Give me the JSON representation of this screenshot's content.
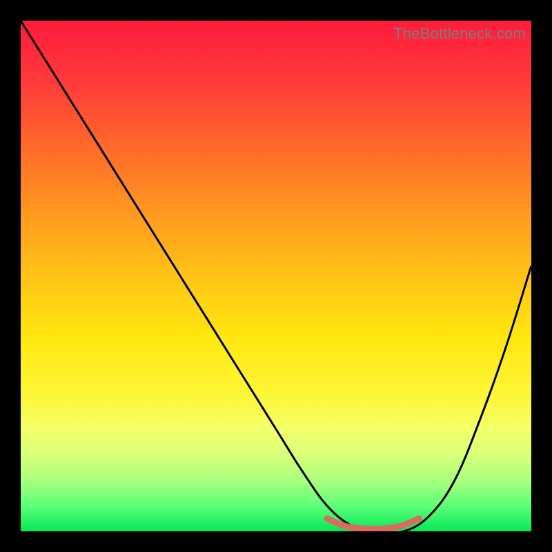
{
  "watermark": "TheBottleneck.com",
  "chart_data": {
    "type": "line",
    "title": "",
    "xlabel": "",
    "ylabel": "",
    "xlim": [
      0,
      100
    ],
    "ylim": [
      0,
      100
    ],
    "grid": false,
    "legend": false,
    "series": [
      {
        "name": "bottleneck-curve",
        "color": "#000000",
        "x": [
          0,
          10,
          20,
          30,
          40,
          50,
          55,
          60,
          65,
          70,
          75,
          80,
          85,
          90,
          95,
          100
        ],
        "y": [
          100,
          84,
          68,
          52,
          36,
          20,
          12,
          5,
          1,
          0,
          0,
          3,
          10,
          22,
          36,
          52
        ]
      },
      {
        "name": "optimal-range-marker",
        "color": "#d96b5f",
        "x": [
          60,
          63,
          66,
          69,
          72,
          75,
          78
        ],
        "y": [
          2.5,
          1.2,
          0.6,
          0.5,
          0.6,
          1.2,
          2.5
        ]
      }
    ],
    "annotations": []
  }
}
